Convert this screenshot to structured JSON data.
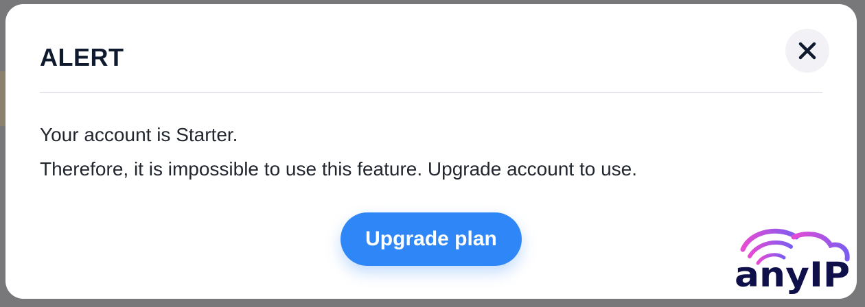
{
  "modal": {
    "title": "ALERT",
    "close_icon": "close-icon",
    "message_lines": [
      "Your account is Starter.",
      "Therefore, it is impossible to use this feature. Upgrade account to use."
    ],
    "primary_button_label": "Upgrade plan"
  },
  "brand": {
    "name": "anyIP",
    "icon": "cloud-wifi-logo"
  },
  "colors": {
    "accent": "#2f86f6",
    "title": "#0f1a2e",
    "text": "#22262e",
    "logo_text": "#0f0f4a",
    "logo_gradient_start": "#e64bd3",
    "logo_gradient_end": "#7b5cf0",
    "overlay": "#78787a"
  }
}
